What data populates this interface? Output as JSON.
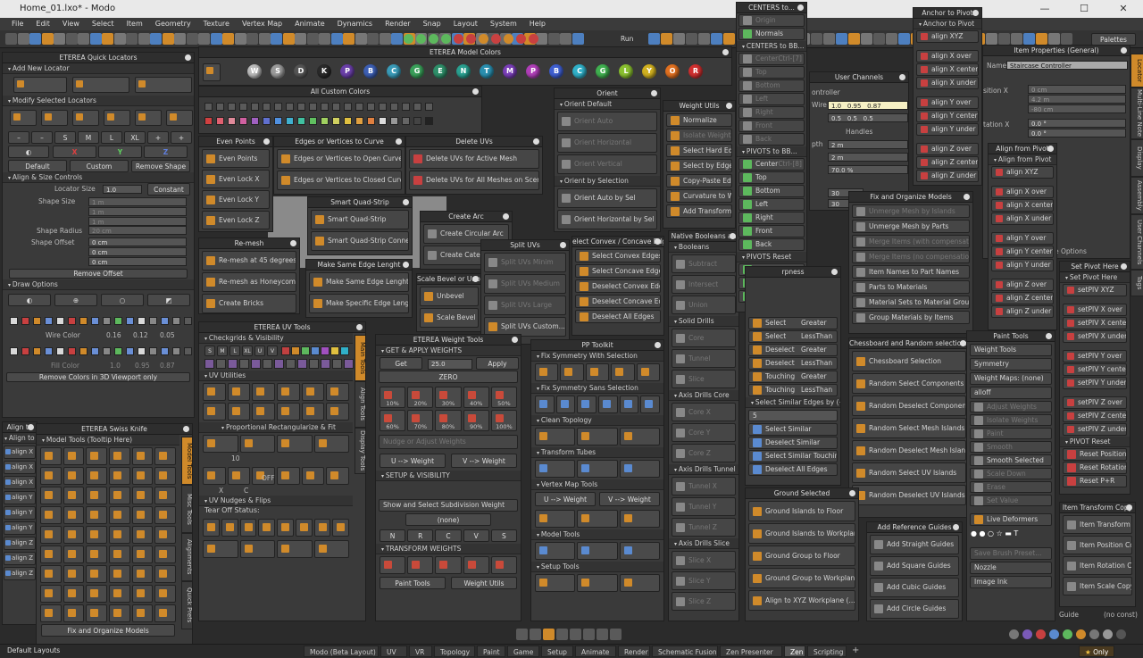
{
  "window": {
    "title": "Home_01.lxo* - Modo",
    "btn_min": "—",
    "btn_max": "☐",
    "btn_close": "✕"
  },
  "menu": [
    "File",
    "Edit",
    "View",
    "Select",
    "Item",
    "Geometry",
    "Texture",
    "Vertex Map",
    "Animate",
    "Dynamics",
    "Render",
    "Snap",
    "Layout",
    "System",
    "Help"
  ],
  "toolbar": {
    "run_label": "Run",
    "palettes_label": "Palettes"
  },
  "quick_locators": {
    "title": "ETEREA Quick Locators",
    "add_new": "Add New Locator",
    "modify": "Modify Selected Locators",
    "sizes": [
      "–",
      "–",
      "S",
      "M",
      "L",
      "XL",
      "+",
      "+"
    ],
    "axes": [
      "X",
      "Y",
      "Z"
    ],
    "presets": [
      "Default",
      "Custom",
      "Remove Shape"
    ],
    "align_size": "Align & Size Controls",
    "locator_size_label": "Locator Size",
    "locator_size_value": "1.0",
    "constant": "Constant",
    "shape_size_label": "Shape Size",
    "shape_size": [
      "1 m",
      "1 m",
      "1 m"
    ],
    "shape_radius_label": "Shape Radius",
    "shape_radius": "20 cm",
    "shape_offset_label": "Shape Offset",
    "shape_offset": [
      "0 cm",
      "0 cm",
      "0 cm"
    ],
    "remove_offset": "Remove Offset",
    "draw_options": "Draw Options",
    "wire_color_label": "Wire Color",
    "wire_color": [
      "0.16",
      "0.12",
      "0.05"
    ],
    "fill_color_label": "Fill Color",
    "fill_color": [
      "1.0",
      "0.95",
      "0.87"
    ],
    "remove_colors": "Remove Colors in 3D Viewport only"
  },
  "model_colors": {
    "title": "ETEREA Model Colors",
    "letters": [
      "W",
      "S",
      "D",
      "K",
      "P",
      "B",
      "C",
      "G",
      "E",
      "N",
      "T",
      "M",
      "P",
      "B",
      "C",
      "G",
      "L",
      "Y",
      "O",
      "R"
    ]
  },
  "custom_colors": {
    "title": "All Custom Colors"
  },
  "even_points": {
    "title": "Even Points",
    "items": [
      "Even Points",
      "Even Lock X",
      "Even Lock Y",
      "Even Lock Z"
    ]
  },
  "edges_curve": {
    "title": "Edges or Vertices to Curve",
    "items": [
      "Edges or Vertices to Open Curve",
      "Edges or Vertices to Closed Curve"
    ]
  },
  "delete_uvs": {
    "title": "Delete UVs",
    "items": [
      "Delete UVs for Active Mesh",
      "Delete UVs for All Meshes on Scene"
    ]
  },
  "orient": {
    "title": "Orient",
    "default_sec": "Orient Default",
    "default_items": [
      "Orient Auto",
      "Orient Horizontal",
      "Orient Vertical"
    ],
    "sel_sec": "Orient by Selection",
    "sel_items": [
      "Orient Auto by Sel",
      "Orient Horizontal by Sel"
    ]
  },
  "weight_utils": {
    "title": "Weight Utils",
    "items": [
      "Normalize",
      "Isolate Weights",
      "Select Hard Edges",
      "Select by Edge W",
      "Copy-Paste Edge W",
      "Curvature to Weig",
      "Add Transform Effe"
    ]
  },
  "smart_quad": {
    "title": "Smart Quad-Strip",
    "items": [
      "Smart Quad-Strip",
      "Smart Quad-Strip Connect"
    ]
  },
  "create_arc": {
    "title": "Create Arc",
    "items": [
      "Create Circular Arc",
      "Create Cate"
    ]
  },
  "remesh": {
    "title": "Re-mesh",
    "items": [
      "Re-mesh at 45 degrees",
      "Re-mesh as Honeycomb",
      "Create Bricks"
    ]
  },
  "same_edge": {
    "title": "Make Same Edge Lenght",
    "items": [
      "Make Same Edge Lenght",
      "Make Specific Edge Lenght"
    ]
  },
  "bevel": {
    "title": "Scale Bevel or Unb...",
    "items": [
      "Unbevel",
      "Scale Bevel"
    ]
  },
  "split_uvs": {
    "title": "Split UVs",
    "items": [
      "Split UVs Minim",
      "Split UVs Medium",
      "Split UVs Large",
      "Split UVs Custom..."
    ]
  },
  "convex": {
    "title": "elect Convex / Concave Edg",
    "items": [
      "Select Convex Edges",
      "Select Concave Edges",
      "Deselect Convex Edges",
      "Deselect Concave Edges",
      "Deselect All Edges"
    ]
  },
  "booleans": {
    "title": "Native Booleans an",
    "sec1": "Booleans",
    "items1": [
      "Subtract",
      "Intersect",
      "Union"
    ],
    "sec2": "Solid Drills",
    "items2": [
      "Core",
      "Tunnel",
      "Slice"
    ],
    "sec3": "Axis Drills Core",
    "items3": [
      "Core X",
      "Core Y",
      "Core Z"
    ],
    "sec4": "Axis Drills Tunnel",
    "items4": [
      "Tunnel X",
      "Tunnel Y",
      "Tunnel Z"
    ],
    "sec5": "Axis Drills Slice",
    "items5": [
      "Slice X",
      "Slice Y",
      "Slice Z"
    ]
  },
  "centers": {
    "title": "CENTERS to...",
    "items": [
      "Origin",
      "Normals"
    ],
    "bb_title": "CENTERS to BB...",
    "bb_items": [
      "Center",
      "Top",
      "Bottom",
      "Left",
      "Right",
      "Front",
      "Back"
    ],
    "bb_shortcut": "Ctrl-[7]",
    "pivots_bb": "PIVOTS to BB...",
    "pivots_items": [
      "Center",
      "Top",
      "Bottom",
      "Left",
      "Right",
      "Front",
      "Back"
    ],
    "pivots_shortcut": "Ctrl-[8]",
    "reset_title": "PIVOTS Reset",
    "reset_items": [
      "Reset Position",
      "Reset Rotation",
      "Reset P+R"
    ]
  },
  "anchor": {
    "title": "Anchor to Pivot",
    "sub": "Anchor to Pivot",
    "items": [
      "align XYZ",
      "align X over",
      "align X center",
      "align X under",
      "align Y over",
      "align Y center",
      "align Y under",
      "align Z over",
      "align Z center",
      "align Z under"
    ]
  },
  "user_channels": {
    "title": "User Channels",
    "controller": "ontroller",
    "wire_label": "Wire",
    "wire": [
      "1.0",
      "0.95",
      "0.87"
    ],
    "fill": [
      "0.5",
      "0.5",
      "0.5"
    ],
    "handles": "Handles",
    "depth_label": "pth",
    "depth": [
      "2 m",
      "2 m",
      "70.0 %"
    ],
    "vals": [
      "30",
      "30"
    ]
  },
  "item_props": {
    "title": "Item Properties (General)",
    "name_label": "Name",
    "name_value": "Staircase Controller",
    "pos_label": "sition X",
    "pos": [
      "0 cm",
      "4.2 m",
      "-80 cm"
    ],
    "rot_label": "tation X",
    "rot": [
      "0.0 °",
      "0.0 °"
    ],
    "rside": "e Options"
  },
  "right_tabs": [
    "Locator",
    "Multi-Line Note",
    "Display",
    "Assembly",
    "User Channels",
    "Tags"
  ],
  "align_from": {
    "title": "Align from Pivot",
    "sub": "Align from Pivot",
    "items": [
      "align XYZ",
      "align X over",
      "align X center",
      "align X under",
      "align Y over",
      "align Y center",
      "align Y under",
      "align Z over",
      "align Z center",
      "align Z under"
    ]
  },
  "set_pivot": {
    "title": "Set Pivot Here",
    "sub": "Set Pivot Here",
    "items": [
      "setPIV XYZ",
      "setPIV X over",
      "setPIV X center",
      "setPIV X under",
      "setPIV Y over",
      "setPIV Y center",
      "setPIV Y under",
      "setPIV Z over",
      "setPIV Z center",
      "setPIV Z under"
    ],
    "reset": "PIVOT Reset",
    "reset_items": [
      "Reset Position",
      "Reset Rotation",
      "Reset P+R"
    ]
  },
  "fix_organize": {
    "title": "Fix and Organize Models",
    "items": [
      "Unmerge Mesh by Islands",
      "Unmerge Mesh by Parts",
      "Merge Items (with compensation)",
      "Merge Items (no compensation)",
      "Item Names to Part Names",
      "Parts to Materials",
      "Material Sets to Material Groups",
      "Group Materials by Items"
    ]
  },
  "chessboard": {
    "title": "Chessboard and Random selections",
    "items": [
      "Chessboard Selection",
      "Random Select Components",
      "Random Deselect Components",
      "Random Select Mesh Islands",
      "Random Deselect Mesh Islands",
      "Random Select UV Islands",
      "Random Deselect UV Islands"
    ]
  },
  "sharpness": {
    "title": "rpness",
    "rows": [
      [
        "Select",
        "Greater"
      ],
      [
        "Select",
        "LessThan"
      ],
      [
        "Deselect",
        "Greater"
      ],
      [
        "Deselect",
        "LessThan"
      ],
      [
        "Touching",
        "Greater"
      ],
      [
        "Touching",
        "LessThan"
      ]
    ],
    "similar_sec": "Select Similar Edges by (+/-)",
    "similar_val": "5",
    "similar_items": [
      "Select Similar",
      "Deselect Similar",
      "Select Similar Touching",
      "Deselect All Edges"
    ]
  },
  "ground": {
    "title": "Ground Selected",
    "items": [
      "Ground Islands to Floor",
      "Ground Islands to Workplane",
      "Ground Group to Floor",
      "Ground Group to Workplane",
      "Align to XYZ Workplane (...)"
    ]
  },
  "ref_guides": {
    "title": "Add Reference Guides",
    "items": [
      "Add Straight Guides",
      "Add Square Guides",
      "Add Cubic Guides",
      "Add Circle Guides"
    ]
  },
  "paint_tools": {
    "title": "Paint Tools",
    "weight_tools": "Weight Tools",
    "symmetry": "Symmetry",
    "weight_maps": "Weight Maps: (none)",
    "falloff": "alloff",
    "items": [
      "Adjust Weights",
      "Isolate Weights",
      "Paint",
      "Smooth",
      "Smooth Selected",
      "Scale Down",
      "Erase",
      "Set Value"
    ],
    "live": "Live Deformers",
    "brush_preset": "Save Brush Preset...",
    "nozzle": "Nozzle",
    "image_ink": "Image Ink",
    "guide": "Guide",
    "no_const": "(no const)"
  },
  "transform_copy": {
    "title": "Item Transform Copy",
    "items": [
      "Item Transform Copy",
      "Item Position Copy",
      "Item Rotation Copy",
      "Item Scale Copy"
    ],
    "tags": [
      "PRS",
      "Pos",
      "Rot",
      "Scale"
    ]
  },
  "uv_tools": {
    "title": "ETEREA UV Tools",
    "checkgrids": "Checkgrids & Visibility",
    "uv_util": "UV Utilities",
    "prop_rect": "Proportional Rectangularize & Fit",
    "val10": "10",
    "nudges": "UV Nudges & Flips",
    "tear_off": "Tear Off Status:",
    "sm": [
      "S",
      "M",
      "L",
      "XL",
      "U",
      "V"
    ],
    "xc": [
      "X",
      "C"
    ],
    "off": "OFF",
    "tabs": [
      "Main Tools",
      "Align Tools",
      "Display Tools"
    ]
  },
  "weight_tools": {
    "title": "ETEREA Weight Tools",
    "get_apply": "GET & APPLY WEIGHTS",
    "get": "Get",
    "val": "25.0",
    "apply": "Apply",
    "zero": "ZERO",
    "pcts": [
      "10%",
      "20%",
      "30%",
      "40%",
      "50%",
      "60%",
      "70%",
      "80%",
      "90%",
      "100%"
    ],
    "nudge": "Nudge or Adjust Weights",
    "u_weight": "U --> Weight",
    "v_weight": "V --> Weight",
    "setup": "SETUP & VISIBILITY",
    "show_sub": "Show and Select Subdivision Weight",
    "none": "(none)",
    "nrcvs": [
      "N",
      "R",
      "C",
      "V",
      "S"
    ],
    "transform": "TRANSFORM WEIGHTS",
    "paint": "Paint Tools",
    "weight_utils": "Weight Utils"
  },
  "pp_toolkit": {
    "title": "PP Toolkit",
    "fix_with": "Fix Symmetry With Selection",
    "fix_sans": "Fix Symmetry Sans Selection",
    "clean": "Clean Topology",
    "tubes": "Transform Tubes",
    "vmap": "Vertex Map Tools",
    "u_weight": "U --> Weight",
    "v_weight": "V --> Weight",
    "model": "Model Tools",
    "setup": "Setup Tools"
  },
  "swiss_knife": {
    "title": "ETEREA Swiss Knife",
    "sec": "Model Tools (Tooltip Here)",
    "tabs": [
      "Model Tools",
      "Misc Tools",
      "Alignments",
      "Quick Prefs"
    ],
    "fix": "Fix and Organize Models"
  },
  "align_to": {
    "title": "Align to",
    "sub": "Align to l",
    "items": [
      "align X",
      "align X",
      "align X",
      "align Y",
      "align Y",
      "align Y",
      "align Z",
      "align Z",
      "align Z"
    ]
  },
  "status": {
    "layouts": "Default Layouts",
    "tabs": [
      "Modo (Beta Layout)",
      "UV",
      "VR",
      "Topology",
      "Paint",
      "Game",
      "Setup",
      "Animate",
      "Render",
      "Schematic Fusion",
      "Zen Presenter",
      "Zen",
      "Scripting"
    ],
    "plus": "+",
    "only": "Only",
    "star": "★"
  },
  "colors": {
    "accent": "#d08a2a",
    "bg": "#2b2b2b",
    "panel": "#3a3a3a"
  }
}
